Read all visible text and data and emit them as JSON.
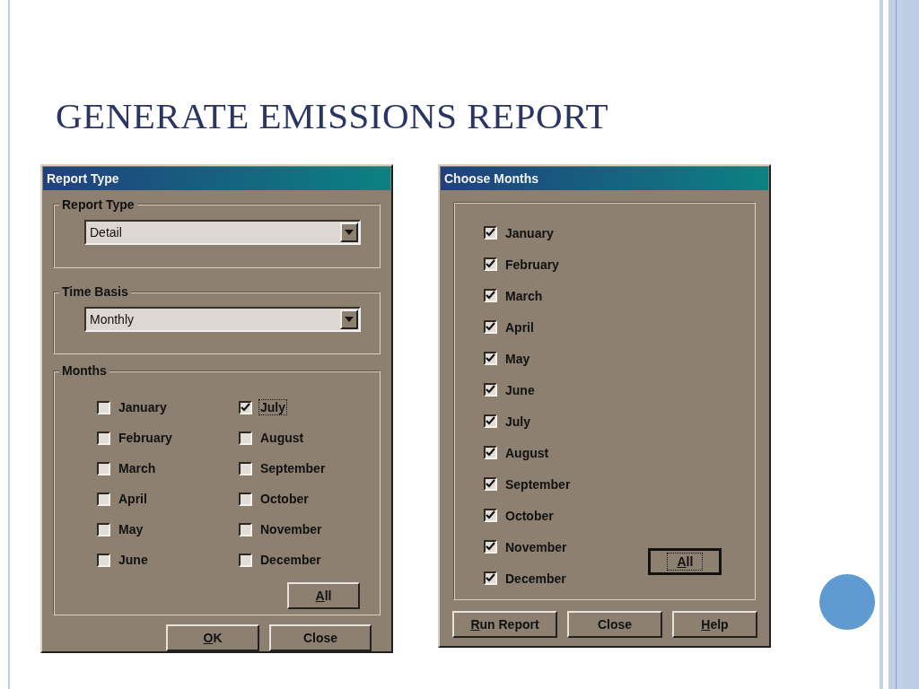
{
  "slide": {
    "title": "GENERATE EMISSIONS REPORT"
  },
  "report_dialog": {
    "title": "Report Type",
    "groups": [
      {
        "kind": "dropdown",
        "label": "Report Type",
        "value": "Detail"
      },
      {
        "kind": "dropdown",
        "label": "Time Basis",
        "value": "Monthly"
      },
      {
        "kind": "checklist",
        "label": "Months",
        "items": [
          {
            "label": "January",
            "checked": false,
            "focused": false
          },
          {
            "label": "February",
            "checked": false,
            "focused": false
          },
          {
            "label": "March",
            "checked": false,
            "focused": false
          },
          {
            "label": "April",
            "checked": false,
            "focused": false
          },
          {
            "label": "May",
            "checked": false,
            "focused": false
          },
          {
            "label": "June",
            "checked": false,
            "focused": false
          },
          {
            "label": "July",
            "checked": true,
            "focused": true
          },
          {
            "label": "August",
            "checked": false,
            "focused": false
          },
          {
            "label": "September",
            "checked": false,
            "focused": false
          },
          {
            "label": "October",
            "checked": false,
            "focused": false
          },
          {
            "label": "November",
            "checked": false,
            "focused": false
          },
          {
            "label": "December",
            "checked": false,
            "focused": false
          }
        ],
        "button": {
          "label": "All",
          "mnemonic": true,
          "focused": false
        }
      }
    ],
    "buttons": [
      {
        "label": "OK",
        "mnemonic": true,
        "focused": false
      },
      {
        "label": "Close",
        "mnemonic": false,
        "focused": false
      }
    ]
  },
  "months_dialog": {
    "title": "Choose Months",
    "items": [
      {
        "label": "January",
        "checked": true,
        "focused": false
      },
      {
        "label": "February",
        "checked": true,
        "focused": false
      },
      {
        "label": "March",
        "checked": true,
        "focused": false
      },
      {
        "label": "April",
        "checked": true,
        "focused": false
      },
      {
        "label": "May",
        "checked": true,
        "focused": false
      },
      {
        "label": "June",
        "checked": true,
        "focused": false
      },
      {
        "label": "July",
        "checked": true,
        "focused": false
      },
      {
        "label": "August",
        "checked": true,
        "focused": false
      },
      {
        "label": "September",
        "checked": true,
        "focused": false
      },
      {
        "label": "October",
        "checked": true,
        "focused": false
      },
      {
        "label": "November",
        "checked": true,
        "focused": false
      },
      {
        "label": "December",
        "checked": true,
        "focused": false
      }
    ],
    "all_button": {
      "label": "All",
      "mnemonic": true,
      "focused": true
    },
    "buttons": [
      {
        "label": "Run Report",
        "mnemonic": true,
        "focused": false
      },
      {
        "label": "Close",
        "mnemonic": false,
        "focused": false
      },
      {
        "label": "Help",
        "mnemonic": true,
        "focused": false
      }
    ]
  }
}
